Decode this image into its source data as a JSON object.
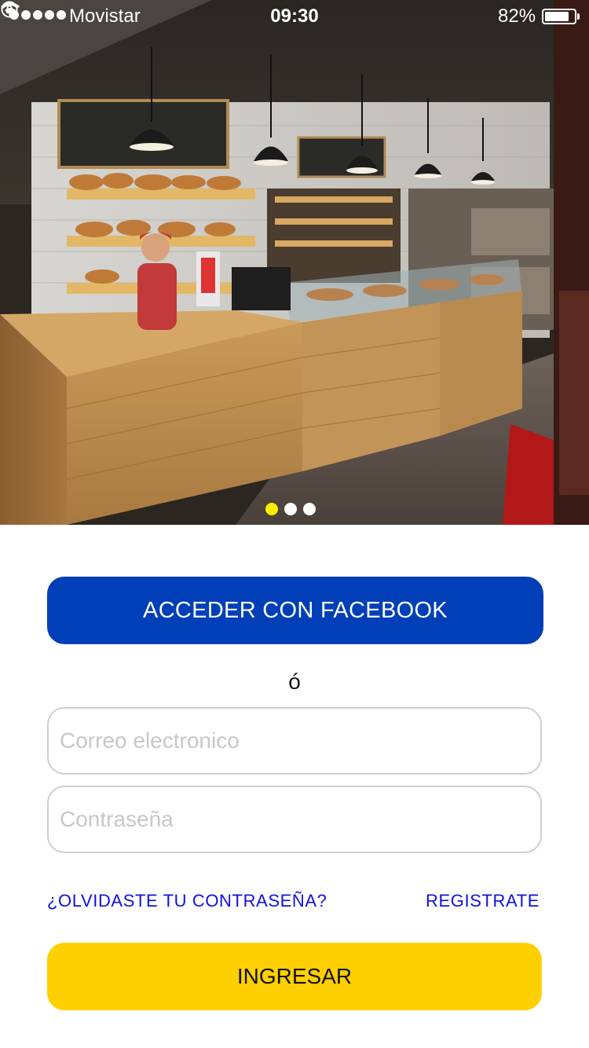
{
  "status_bar": {
    "carrier": "Movistar",
    "time": "09:30",
    "battery_percent": "82%",
    "battery_level": 0.82,
    "icons": [
      "signal-dots-icon",
      "wifi-icon",
      "rotation-lock-icon",
      "battery-icon"
    ]
  },
  "carousel": {
    "page_count": 3,
    "active_index": 0,
    "active_color": "#ffee00",
    "inactive_color": "#ffffff"
  },
  "login": {
    "facebook_label": "ACCEDER CON FACEBOOK",
    "or_text": "ó",
    "email_placeholder": "Correo electronico",
    "password_placeholder": "Contraseña",
    "forgot_label": "¿OLVIDASTE TU CONTRASEÑA?",
    "register_label": "REGISTRATE",
    "submit_label": "INGRESAR"
  },
  "colors": {
    "facebook_button": "#003fb8",
    "submit_button": "#ffd000",
    "link": "#1010e0",
    "field_border": "#cfcfcf"
  }
}
